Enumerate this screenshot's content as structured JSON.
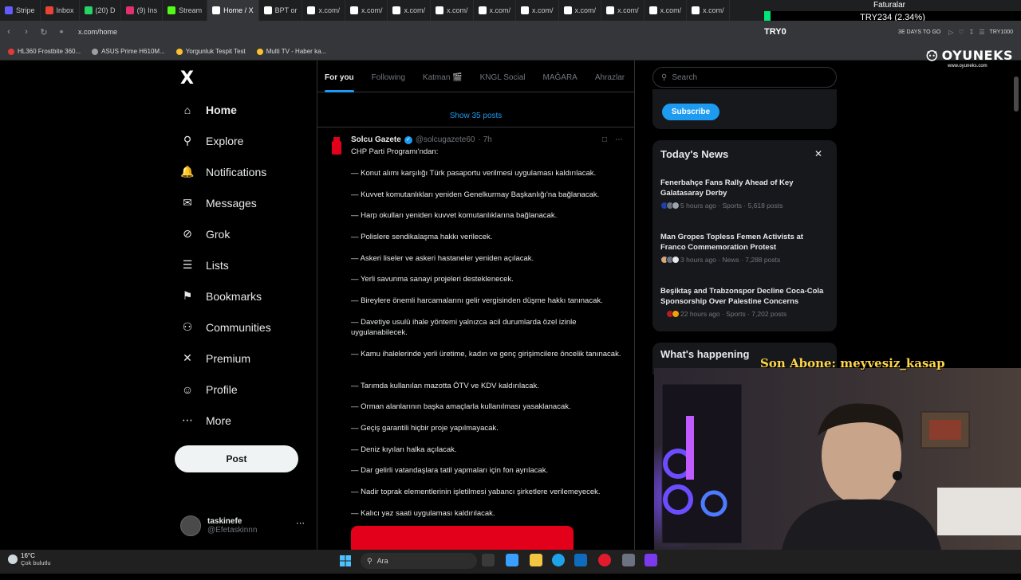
{
  "browser": {
    "tabs": [
      {
        "label": "Stripe",
        "color": "#635bff"
      },
      {
        "label": "Inbox",
        "color": "#ea4335"
      },
      {
        "label": "(20) D",
        "color": "#25d366"
      },
      {
        "label": "(9) Ins",
        "color": "#e1306c"
      },
      {
        "label": "Stream",
        "color": "#53fc18"
      },
      {
        "label": "Home / X",
        "color": "#ffffff"
      },
      {
        "label": "BPT or",
        "color": "#ffffff"
      },
      {
        "label": "x.com/",
        "color": "#ffffff"
      },
      {
        "label": "x.com/",
        "color": "#ffffff"
      },
      {
        "label": "x.com/",
        "color": "#ffffff"
      },
      {
        "label": "x.com/",
        "color": "#ffffff"
      },
      {
        "label": "x.com/",
        "color": "#ffffff"
      },
      {
        "label": "x.com/",
        "color": "#ffffff"
      },
      {
        "label": "x.com/",
        "color": "#ffffff"
      },
      {
        "label": "x.com/",
        "color": "#ffffff"
      },
      {
        "label": "x.com/",
        "color": "#ffffff"
      },
      {
        "label": "x.com/",
        "color": "#ffffff"
      }
    ],
    "active_tab": 5,
    "url": "x.com/home",
    "bookmarks": [
      {
        "label": "HL360 Frostbite 360...",
        "color": "#e53935"
      },
      {
        "label": "ASUS Prime H610M...",
        "color": "#9e9e9e"
      },
      {
        "label": "Yorgunluk Tespit Test",
        "color": "#fbc02d"
      },
      {
        "label": "Multi TV - Haber ka...",
        "color": "#fbc02d"
      }
    ],
    "ext_right": "3E DAYS TO GO",
    "try_badge": "TRY1000"
  },
  "overlay": {
    "faturalar": "Faturalar",
    "ticker": "TRY234 (2.34%)",
    "try0": "TRY0",
    "logo_text": "OYUNEKS",
    "logo_sub": "www.oyuneks.com",
    "son_abone": "Son Abone: meyvesiz_kasap"
  },
  "nav": {
    "logo": "X",
    "items": [
      {
        "label": "Home",
        "icon": "home-icon",
        "glyph": "⌂"
      },
      {
        "label": "Explore",
        "icon": "search-icon",
        "glyph": "⚲"
      },
      {
        "label": "Notifications",
        "icon": "bell-icon",
        "glyph": "🔔"
      },
      {
        "label": "Messages",
        "icon": "mail-icon",
        "glyph": "✉"
      },
      {
        "label": "Grok",
        "icon": "grok-icon",
        "glyph": "⊘"
      },
      {
        "label": "Lists",
        "icon": "list-icon",
        "glyph": "☰"
      },
      {
        "label": "Bookmarks",
        "icon": "bookmark-icon",
        "glyph": "⚑"
      },
      {
        "label": "Communities",
        "icon": "people-icon",
        "glyph": "⚇"
      },
      {
        "label": "Premium",
        "icon": "x-premium-icon",
        "glyph": "✕"
      },
      {
        "label": "Profile",
        "icon": "person-icon",
        "glyph": "☺"
      },
      {
        "label": "More",
        "icon": "more-circle-icon",
        "glyph": "⋯"
      }
    ],
    "post_label": "Post",
    "user_name": "taskinefe",
    "user_handle": "@Efetaskinnn"
  },
  "timeline": {
    "tabs": [
      "For you",
      "Following",
      "Katman 🎬",
      "KNGL Social",
      "MAĞARA",
      "Ahrazlar"
    ],
    "selected_tab": 0,
    "show_posts": "Show 35 posts",
    "tweet": {
      "name": "Solcu Gazete",
      "handle": "@solcugazete60",
      "time": "· 7h",
      "title": "CHP Parti Programı'ndan:",
      "lines": [
        "— Konut alımı karşılığı Türk pasaportu verilmesi uygulaması kaldırılacak.",
        "— Kuvvet komutanlıkları yeniden Genelkurmay Başkanlığı'na bağlanacak.",
        "— Harp okulları yeniden kuvvet komutanlıklarına bağlanacak.",
        "— Polislere sendikalaşma hakkı verilecek.",
        "— Askeri liseler ve askeri hastaneler yeniden açılacak.",
        "— Yerli savunma sanayi projeleri desteklenecek.",
        "— Bireylere önemli harcamalarını gelir vergisinden düşme hakkı tanınacak.",
        "— Davetiye usulü ihale yöntemi yalnızca acil durumlarda özel izinle uygulanabilecek.",
        "— Kamu ihalelerinde yerli üretime, kadın ve genç girişimcilere öncelik tanınacak.",
        "— Tarımda kullanılan mazotta ÖTV ve KDV kaldırılacak.",
        "— Orman alanlarının başka amaçlarla kullanılması yasaklanacak.",
        "— Geçiş garantili hiçbir proje yapılmayacak.",
        "— Deniz kıyıları halka açılacak.",
        "— Dar gelirli vatandaşlara tatil yapmaları için fon ayrılacak.",
        "— Nadir toprak elementlerinin işletilmesi yabancı şirketlere verilemeyecek.",
        "— Kalıcı yaz saati uygulaması kaldırılacak."
      ]
    }
  },
  "right": {
    "search_placeholder": "Search",
    "subscribe_label": "Subscribe",
    "news_title": "Today's News",
    "news": [
      {
        "headline": "Fenerbahçe Fans Rally Ahead of Key Galatasaray Derby",
        "meta": "5 hours ago · Sports · 5,618 posts",
        "colors": [
          "#1e40af",
          "#6b7280",
          "#9ca3af"
        ]
      },
      {
        "headline": "Man Gropes Topless Femen Activists at Franco Commemoration Protest",
        "meta": "3 hours ago · News · 7,288 posts",
        "colors": [
          "#d6a77a",
          "#6b7280",
          "#e5e7eb"
        ]
      },
      {
        "headline": "Beşiktaş and Trabzonspor Decline Coca-Cola Sponsorship Over Palestine Concerns",
        "meta": "22 hours ago · Sports · 7,202 posts",
        "colors": [
          "#111827",
          "#b91c1c",
          "#f59e0b"
        ]
      }
    ],
    "happening_title": "What's happening"
  },
  "taskbar": {
    "temp": "16°C",
    "weather": "Çok bulutlu",
    "search_placeholder": "Ara"
  }
}
